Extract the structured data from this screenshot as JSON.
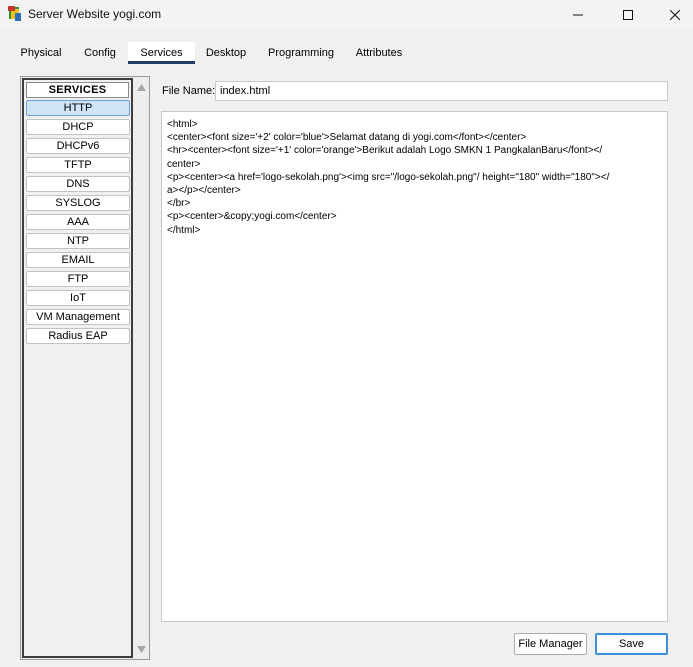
{
  "window": {
    "title": "Server Website yogi.com",
    "app_icon": "packet-tracer-server-icon"
  },
  "tabs": [
    {
      "label": "Physical",
      "active": false
    },
    {
      "label": "Config",
      "active": false
    },
    {
      "label": "Services",
      "active": true
    },
    {
      "label": "Desktop",
      "active": false
    },
    {
      "label": "Programming",
      "active": false
    },
    {
      "label": "Attributes",
      "active": false
    }
  ],
  "services": {
    "header": "SERVICES",
    "selected": "HTTP",
    "items": [
      "HTTP",
      "DHCP",
      "DHCPv6",
      "TFTP",
      "DNS",
      "SYSLOG",
      "AAA",
      "NTP",
      "EMAIL",
      "FTP",
      "IoT",
      "VM Management",
      "Radius EAP"
    ]
  },
  "file": {
    "label": "File Name:",
    "name": "index.html"
  },
  "editor": {
    "lines": [
      "<html>",
      "<center><font size='+2' color='blue'>Selamat datang di yogi.com</font></center>",
      "<hr><center><font size='+1' color='orange'>Berikut adalah Logo SMKN 1 PangkalanBaru</font></",
      "center>",
      "<p><center><a href='logo-sekolah.png'><img src=\"/logo-sekolah.png\"/ height=\"180\" width=\"180\"></",
      "a></p></center>",
      "</br>",
      "<p><center>&copy;yogi.com</center>",
      "</html>"
    ]
  },
  "buttons": {
    "file_manager": "File Manager",
    "save": "Save"
  },
  "colors": {
    "active_tab_underline": "#1e3f66",
    "selected_service": "#cfe4f7",
    "save_border": "#3c8fd8"
  }
}
